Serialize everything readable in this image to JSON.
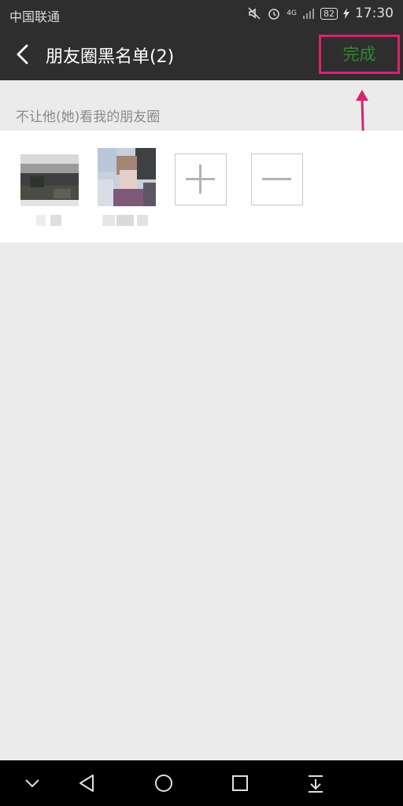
{
  "status_bar": {
    "carrier": "中国联通",
    "network": "4G",
    "battery": "82",
    "time": "17:30"
  },
  "header": {
    "title": "朋友圈黑名单(2)",
    "done_label": "完成"
  },
  "section": {
    "label": "不让他(她)看我的朋友圈"
  },
  "colors": {
    "header_bg": "#2e2e2e",
    "accent_green": "#2f8a2b",
    "annotation_pink": "#d6246e",
    "page_bg": "#ebebeb"
  },
  "icons": {
    "back": "chevron-left-icon",
    "add": "plus-icon",
    "remove": "minus-icon",
    "nav_collapse": "chevron-down-icon",
    "nav_back": "triangle-back-icon",
    "nav_home": "circle-home-icon",
    "nav_recent": "square-recent-icon",
    "nav_notifications": "pull-down-icon"
  }
}
